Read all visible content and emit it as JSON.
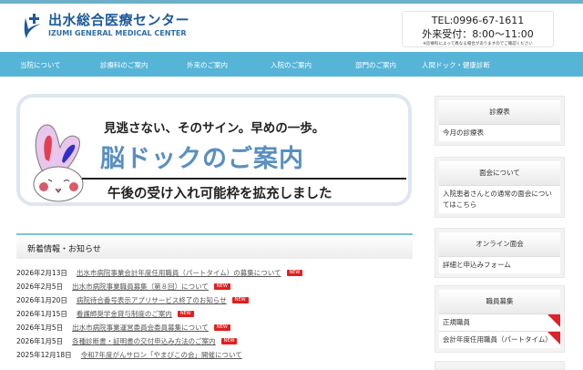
{
  "header": {
    "logo_jp": "出水総合医療センター",
    "logo_en": "IZUMI GENERAL MEDICAL CENTER",
    "tel": "TEL:0996-67-1611",
    "hours": "外来受付：8:00〜11:00",
    "note": "※診療科によって異なる場合がありますのでご確認ください"
  },
  "nav": [
    "当院について",
    "診療科のご案内",
    "外来のご案内",
    "入院のご案内",
    "部門のご案内",
    "人間ドック・健康診断"
  ],
  "banner": {
    "arc_text": "出水総合医療センター",
    "line1": "見逃さない、そのサイン。早めの一歩。",
    "title": "脳ドックのご案内",
    "line3": "午後の受け入れ可能枠を拡充しました"
  },
  "news": {
    "heading": "新着情報・お知らせ",
    "new_label": "NEW",
    "items": [
      {
        "date": "2026年2月13日",
        "title": "出水市病院事業会計年度任用職員（パートタイム）の募集について",
        "new": true
      },
      {
        "date": "2026年2月5日",
        "title": "出水市病院事業職員募集（第８回）について",
        "new": true
      },
      {
        "date": "2026年1月20日",
        "title": "病院待合番号表示アプリサービス終了のお知らせ",
        "new": true
      },
      {
        "date": "2026年1月15日",
        "title": "看護師奨学金貸与制度のご案内",
        "new": true
      },
      {
        "date": "2026年1月5日",
        "title": "出水市病院事業運営委員会委員募集について",
        "new": true
      },
      {
        "date": "2026年1月5日",
        "title": "各種診断書・証明書の交付申込み方法のご案内",
        "new": true
      },
      {
        "date": "2025年12月18日",
        "title": "令和7年度がんサロン「やまびこの会」開催について",
        "new": false
      }
    ]
  },
  "sidebar": [
    {
      "title": "診療表",
      "items": [
        "今月の診療表"
      ]
    },
    {
      "title": "面会について",
      "items": [
        "入院患者さんとの通常の面会についてはこちら"
      ]
    },
    {
      "title": "オンライン面会",
      "items": [
        "詳細と申込みフォーム"
      ]
    },
    {
      "title": "職員募集",
      "items": [
        "正規職員",
        "会計年度任用職員（パートタイム）"
      ]
    }
  ],
  "colors": {
    "nav": "#56b4d7",
    "brand": "#1d5a9a",
    "new": "#e02020"
  }
}
